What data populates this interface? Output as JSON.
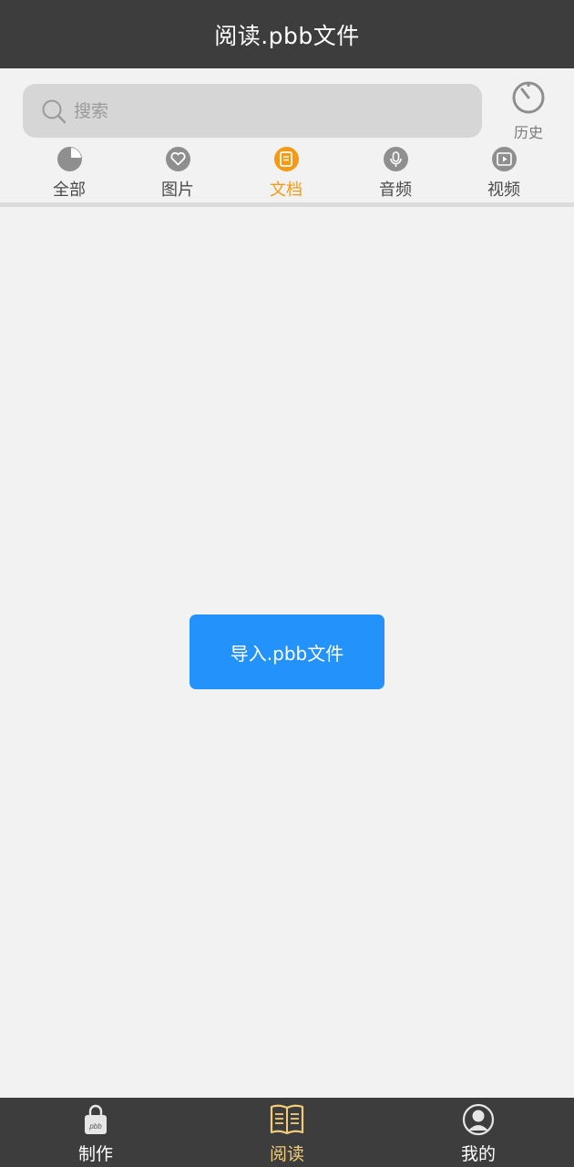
{
  "header": {
    "title": "阅读.pbb文件"
  },
  "search": {
    "placeholder": "搜索",
    "value": ""
  },
  "history": {
    "label": "历史",
    "icon": "timer-icon"
  },
  "tabs": [
    {
      "label": "全部",
      "icon": "pie-chart-icon",
      "active": false
    },
    {
      "label": "图片",
      "icon": "heart-icon",
      "active": false
    },
    {
      "label": "文档",
      "icon": "document-icon",
      "active": true
    },
    {
      "label": "音频",
      "icon": "microphone-icon",
      "active": false
    },
    {
      "label": "视频",
      "icon": "video-play-icon",
      "active": false
    }
  ],
  "main": {
    "import_label": "导入.pbb文件"
  },
  "bottom_nav": [
    {
      "label": "制作",
      "icon": "lock-pbb-icon",
      "active": false
    },
    {
      "label": "阅读",
      "icon": "open-book-icon",
      "active": true
    },
    {
      "label": "我的",
      "icon": "user-avatar-icon",
      "active": false
    }
  ],
  "icon_text": {
    "lock": "pbb"
  },
  "colors": {
    "bar": "#3d3d3d",
    "background": "#f2f2f2",
    "accent": "#f59a12",
    "button": "#2393fb",
    "nav_active": "#f2cc7a"
  }
}
